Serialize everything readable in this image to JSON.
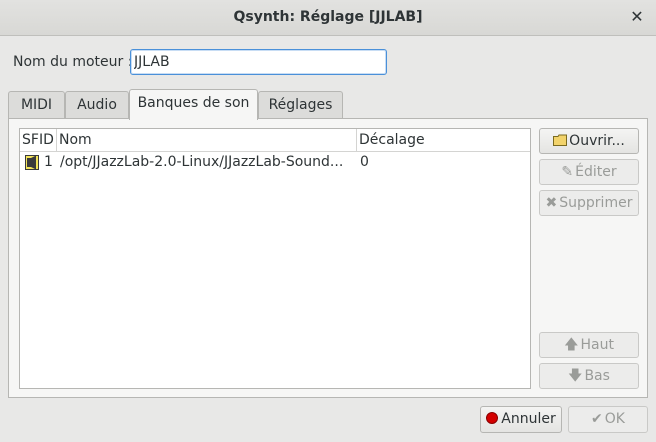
{
  "window": {
    "title": "Qsynth: Réglage [JJLAB]",
    "close_icon": "close-icon"
  },
  "engine": {
    "label": "Nom du moteur :",
    "value": "JJLAB"
  },
  "tabs": [
    {
      "label": "MIDI"
    },
    {
      "label": "Audio"
    },
    {
      "label": "Banques de son"
    },
    {
      "label": "Réglages"
    }
  ],
  "active_tab": "Banques de son",
  "soundfonts": {
    "columns": [
      "SFID",
      "Nom",
      "Décalage"
    ],
    "rows": [
      {
        "sfid": "1",
        "name": "/opt/JJazzLab-2.0-Linux/JJazzLab-Sound...",
        "offset": "0"
      }
    ]
  },
  "side_buttons": {
    "open": "Ouvrir...",
    "edit": "Éditer",
    "remove": "Supprimer",
    "up": "Haut",
    "down": "Bas"
  },
  "footer": {
    "cancel": "Annuler",
    "ok": "OK"
  },
  "colors": {
    "accent": "#4a90d9",
    "cancel_dot": "#d40000"
  }
}
